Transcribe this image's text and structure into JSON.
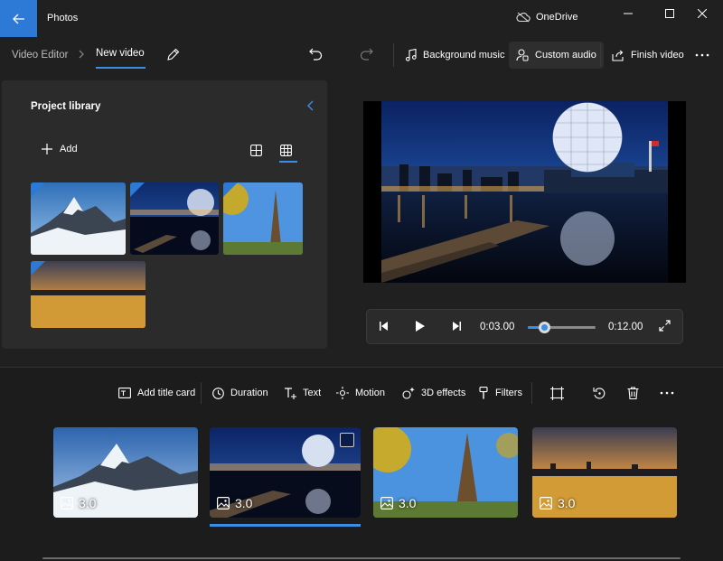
{
  "titlebar": {
    "app_title": "Photos",
    "onedrive_label": "OneDrive",
    "accent": "#2d7ad6"
  },
  "toolbar": {
    "breadcrumb_root": "Video Editor",
    "breadcrumb_current": "New video",
    "background_music": "Background music",
    "custom_audio": "Custom audio",
    "finish_video": "Finish video"
  },
  "library": {
    "title": "Project library",
    "add_label": "Add",
    "items": [
      {
        "name": "Mountain",
        "icon": "mountain-photo"
      },
      {
        "name": "Science World night",
        "icon": "dome-photo"
      },
      {
        "name": "Eiffel Tower",
        "icon": "eiffel-photo"
      },
      {
        "name": "Skyline sunset",
        "icon": "skyline-photo"
      }
    ]
  },
  "player": {
    "current_time": "0:03.00",
    "total_time": "0:12.00",
    "progress": 0.25
  },
  "storyboard": {
    "add_title_card": "Add title card",
    "duration": "Duration",
    "text": "Text",
    "motion": "Motion",
    "effects_3d": "3D effects",
    "filters": "Filters",
    "clips": [
      {
        "duration": "3.0",
        "selected": false
      },
      {
        "duration": "3.0",
        "selected": true
      },
      {
        "duration": "3.0",
        "selected": false
      },
      {
        "duration": "3.0",
        "selected": false
      }
    ]
  }
}
